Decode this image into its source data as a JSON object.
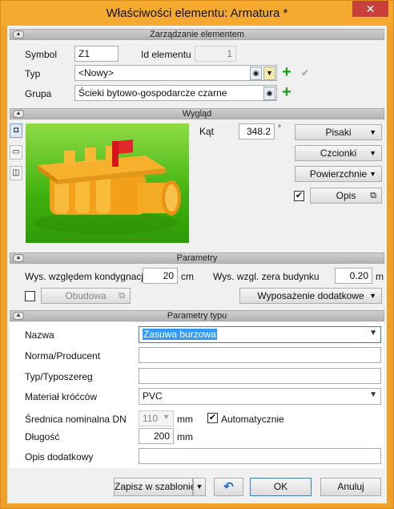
{
  "window": {
    "title": "Właściwości elementu: Armatura *",
    "close_glyph": "✕"
  },
  "sections": {
    "zarzadzanie": "Zarządzanie elementem",
    "wyglad": "Wygląd",
    "parametry": "Parametry",
    "parametry_typu": "Parametry typu"
  },
  "zarzadzanie": {
    "symbol_label": "Symbol",
    "symbol_value": "Z1",
    "id_label": "Id elementu",
    "id_value": "1",
    "typ_label": "Typ",
    "typ_value": "<Nowy>",
    "grupa_label": "Grupa",
    "grupa_value": "Ścieki bytowo-gospodarcze czarne"
  },
  "wyglad": {
    "kat_label": "Kąt",
    "kat_value": "348.2",
    "kat_unit": "°",
    "pisaki": "Pisaki",
    "czcionki": "Czcionki",
    "powierzchnie": "Powierzchnie",
    "opis": "Opis",
    "opis_checked": true
  },
  "parametry": {
    "wys_kond_label": "Wys. względem kondygnacji",
    "wys_kond_value": "20",
    "wys_kond_unit": "cm",
    "wys_zera_label": "Wys. wzgl. zera budynku",
    "wys_zera_value": "0.20",
    "wys_zera_unit": "m",
    "obudowa": "Obudowa",
    "wyposazenie": "Wyposażenie dodatkowe"
  },
  "parametry_typu": {
    "nazwa_label": "Nazwa",
    "nazwa_value": "Zasuwa burzowa",
    "norma_label": "Norma/Producent",
    "norma_value": "",
    "typoszereg_label": "Typ/Typoszereg",
    "typoszereg_value": "",
    "material_label": "Materiał króćców",
    "material_value": "PVC",
    "srednica_label": "Średnica nominalna DN",
    "srednica_value": "110",
    "srednica_unit": "mm",
    "auto_label": "Automatycznie",
    "auto_checked": true,
    "dlugosc_label": "Długość",
    "dlugosc_value": "200",
    "dlugosc_unit": "mm",
    "opis_dod_label": "Opis dodatkowy",
    "opis_dod_value": ""
  },
  "footer": {
    "zapisz": "Zapisz w szablonie",
    "ok": "OK",
    "anuluj": "Anuluj"
  }
}
